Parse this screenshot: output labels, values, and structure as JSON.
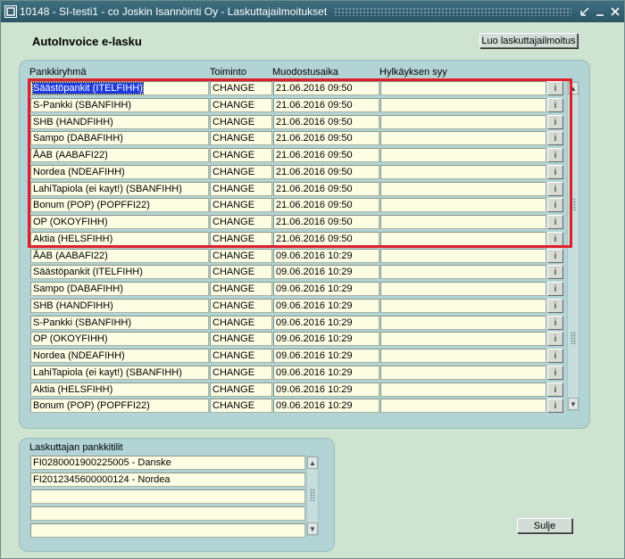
{
  "window": {
    "title": "10148 - SI-testi1 - co Joskin Isannöinti Oy - Laskuttajailmoitukset",
    "controls": [
      "minimize",
      "restore",
      "close"
    ]
  },
  "heading": "AutoInvoice e-lasku",
  "create_button_label": "Luo laskuttajailmoitus",
  "table": {
    "columns": [
      "Pankkiryhmä",
      "Toiminto",
      "Muodostusaika",
      "Hylkäyksen syy"
    ],
    "info_button_label": "i",
    "rows": [
      {
        "bank": "Säästöpankit (ITELFIHH)",
        "action": "CHANGE",
        "time": "21.06.2016 09:50",
        "reason": ""
      },
      {
        "bank": "S-Pankki (SBANFIHH)",
        "action": "CHANGE",
        "time": "21.06.2016 09:50",
        "reason": ""
      },
      {
        "bank": "SHB (HANDFIHH)",
        "action": "CHANGE",
        "time": "21.06.2016 09:50",
        "reason": ""
      },
      {
        "bank": "Sampo (DABAFIHH)",
        "action": "CHANGE",
        "time": "21.06.2016 09:50",
        "reason": ""
      },
      {
        "bank": "ÅAB (AABAFI22)",
        "action": "CHANGE",
        "time": "21.06.2016 09:50",
        "reason": ""
      },
      {
        "bank": "Nordea (NDEAFIHH)",
        "action": "CHANGE",
        "time": "21.06.2016 09:50",
        "reason": ""
      },
      {
        "bank": "LahiTapiola (ei kayt!) (SBANFIHH)",
        "action": "CHANGE",
        "time": "21.06.2016 09:50",
        "reason": ""
      },
      {
        "bank": "Bonum (POP) (POPFFI22)",
        "action": "CHANGE",
        "time": "21.06.2016 09:50",
        "reason": ""
      },
      {
        "bank": "OP (OKOYFIHH)",
        "action": "CHANGE",
        "time": "21.06.2016 09:50",
        "reason": ""
      },
      {
        "bank": "Aktia (HELSFIHH)",
        "action": "CHANGE",
        "time": "21.06.2016 09:50",
        "reason": ""
      },
      {
        "bank": "ÅAB (AABAFI22)",
        "action": "CHANGE",
        "time": "09.06.2016 10:29",
        "reason": ""
      },
      {
        "bank": "Säästöpankit (ITELFIHH)",
        "action": "CHANGE",
        "time": "09.06.2016 10:29",
        "reason": ""
      },
      {
        "bank": "Sampo (DABAFIHH)",
        "action": "CHANGE",
        "time": "09.06.2016 10:29",
        "reason": ""
      },
      {
        "bank": "SHB (HANDFIHH)",
        "action": "CHANGE",
        "time": "09.06.2016 10:29",
        "reason": ""
      },
      {
        "bank": "S-Pankki (SBANFIHH)",
        "action": "CHANGE",
        "time": "09.06.2016 10:29",
        "reason": ""
      },
      {
        "bank": "OP (OKOYFIHH)",
        "action": "CHANGE",
        "time": "09.06.2016 10:29",
        "reason": ""
      },
      {
        "bank": "Nordea (NDEAFIHH)",
        "action": "CHANGE",
        "time": "09.06.2016 10:29",
        "reason": ""
      },
      {
        "bank": "LahiTapiola (ei kayt!) (SBANFIHH)",
        "action": "CHANGE",
        "time": "09.06.2016 10:29",
        "reason": ""
      },
      {
        "bank": "Aktia (HELSFIHH)",
        "action": "CHANGE",
        "time": "09.06.2016 10:29",
        "reason": ""
      },
      {
        "bank": "Bonum (POP) (POPFFI22)",
        "action": "CHANGE",
        "time": "09.06.2016 10:29",
        "reason": ""
      }
    ]
  },
  "accounts": {
    "label": "Laskuttajan pankkitilit",
    "rows": [
      "FI0280001900225005 - Danske",
      "FI2012345600000124 - Nordea",
      "",
      "",
      ""
    ]
  },
  "close_button_label": "Sulje",
  "colors": {
    "window_bg": "#cfe3d1",
    "panel_bg": "#b2d4d4",
    "titlebar": "#2a5666",
    "field_bg": "#fdfde4",
    "selection": "#1d3ae0",
    "highlight_border": "#e01e2a"
  }
}
